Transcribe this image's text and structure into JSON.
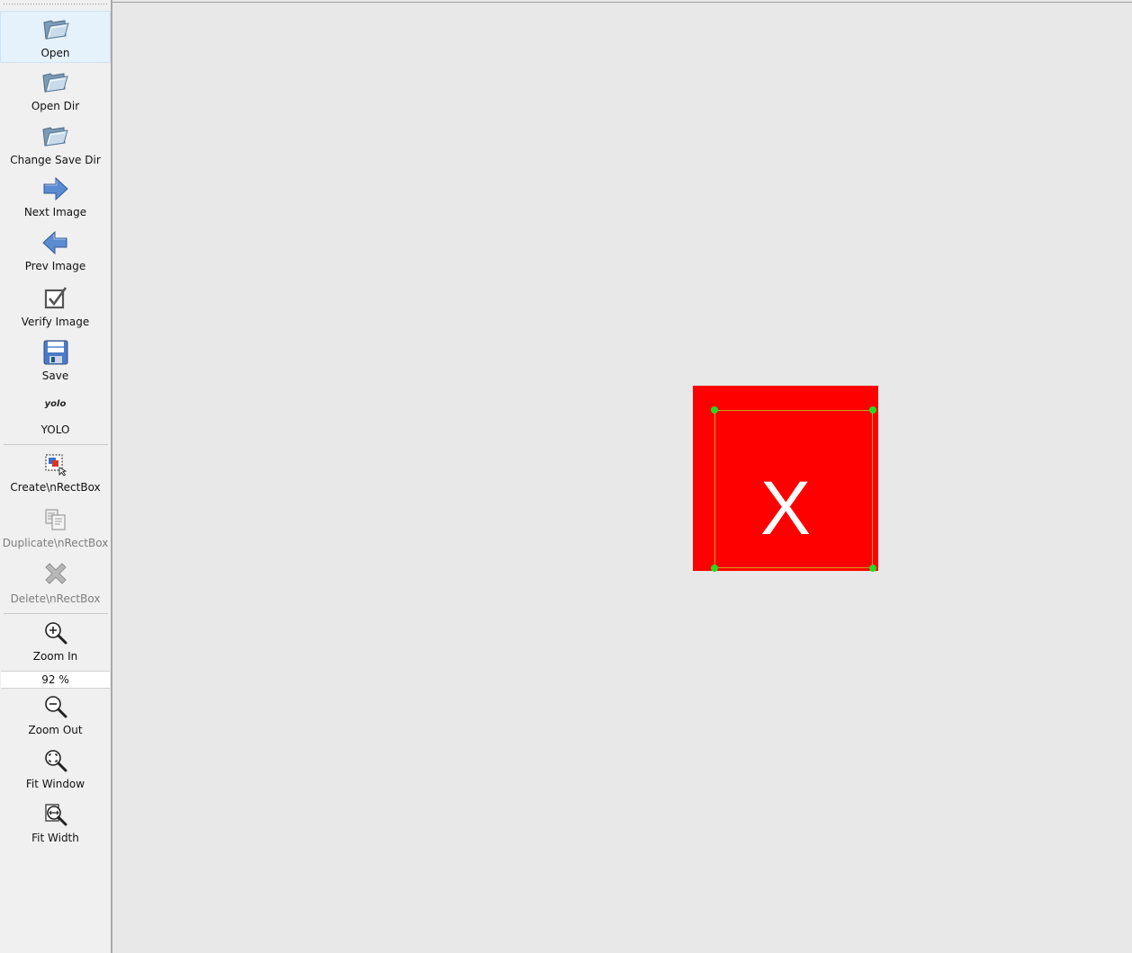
{
  "toolbar": {
    "open": "Open",
    "open_dir": "Open Dir",
    "change_save_dir": "Change Save Dir",
    "next_image": "Next Image",
    "prev_image": "Prev Image",
    "verify_image": "Verify Image",
    "save": "Save",
    "yolo_logo": "yolo",
    "yolo": "YOLO",
    "create_rectbox": "Create\\nRectBox",
    "duplicate_rectbox": "Duplicate\\nRectBox",
    "delete_rectbox": "Delete\\nRectBox",
    "zoom_in": "Zoom In",
    "zoom_value": "92 %",
    "zoom_out": "Zoom Out",
    "fit_window": "Fit Window",
    "fit_width": "Fit Width"
  },
  "icons": {
    "open": "folder-open-icon",
    "open_dir": "folder-open-icon",
    "change_save_dir": "folder-open-icon",
    "next_image": "arrow-right-icon",
    "prev_image": "arrow-left-icon",
    "verify_image": "checkbox-icon",
    "save": "floppy-disk-icon",
    "create_rectbox": "create-box-icon",
    "duplicate_rectbox": "duplicate-icon",
    "delete_rectbox": "delete-x-icon",
    "zoom_in": "zoom-in-icon",
    "zoom_out": "zoom-out-icon",
    "fit_window": "fit-window-icon",
    "fit_width": "fit-width-icon"
  },
  "canvas": {
    "image_letter": "X",
    "image_color": "#ff0000",
    "bbox_color": "#c8a020",
    "handle_color": "#22dd22"
  }
}
